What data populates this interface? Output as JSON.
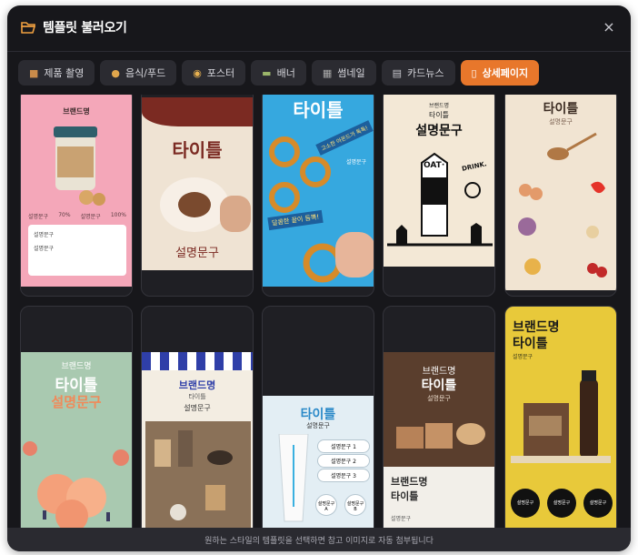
{
  "header": {
    "title": "템플릿 불러오기",
    "folder_icon": "folder-open-icon",
    "close_label": "×"
  },
  "tabs": [
    {
      "label": "제품 촬영",
      "icon": "box-icon",
      "active": false
    },
    {
      "label": "음식/푸드",
      "icon": "burger-icon",
      "active": false
    },
    {
      "label": "포스터",
      "icon": "palette-icon",
      "active": false
    },
    {
      "label": "배너",
      "icon": "banner-icon",
      "active": false
    },
    {
      "label": "썸네일",
      "icon": "clapper-icon",
      "active": false
    },
    {
      "label": "카드뉴스",
      "icon": "cards-icon",
      "active": false
    },
    {
      "label": "상세페이지",
      "icon": "document-icon",
      "active": true
    }
  ],
  "cards": {
    "c1": {
      "brand": "브랜드명",
      "pct1": "70%",
      "pct2": "100%",
      "item": "설명문구",
      "check1": "설명문구",
      "check2": "설명문구"
    },
    "c2": {
      "title": "타이틀",
      "desc": "설명문구"
    },
    "c3": {
      "title": "타이틀",
      "tag1": "고소한 아몬드가 톡톡!",
      "tag2": "달콤한 꿀이 듬뿍!",
      "desc": "설명문구"
    },
    "c4": {
      "brand": "브랜드명",
      "title": "타이틀",
      "main": "설명문구",
      "oat": "OAT·",
      "drink": "DRINK."
    },
    "c5": {
      "title": "타이틀",
      "desc": "설명문구"
    },
    "c6": {
      "brand": "브랜드명",
      "title": "타이틀",
      "main": "설명문구"
    },
    "c7": {
      "brand": "브랜드명",
      "title": "타이틀",
      "desc": "설명문구"
    },
    "c8": {
      "title": "타이틀",
      "desc": "설명문구",
      "items": [
        "설명문구 1",
        "설명문구 2",
        "설명문구 3"
      ],
      "a": "설명문구 A",
      "b": "설명문구 B"
    },
    "c9": {
      "brand": "브랜드명",
      "title": "타이틀",
      "desc": "설명문구",
      "brand2": "브랜드명",
      "title2": "타이틀"
    },
    "c10": {
      "brand": "브랜드명",
      "title": "타이틀",
      "desc": "설명문구",
      "circles": [
        "설명문구",
        "설명문구",
        "설명문구"
      ]
    }
  },
  "footer": {
    "text": "원하는 스타일의 템플릿을 선택하면 참고 이미지로 자동 첨부됩니다"
  }
}
